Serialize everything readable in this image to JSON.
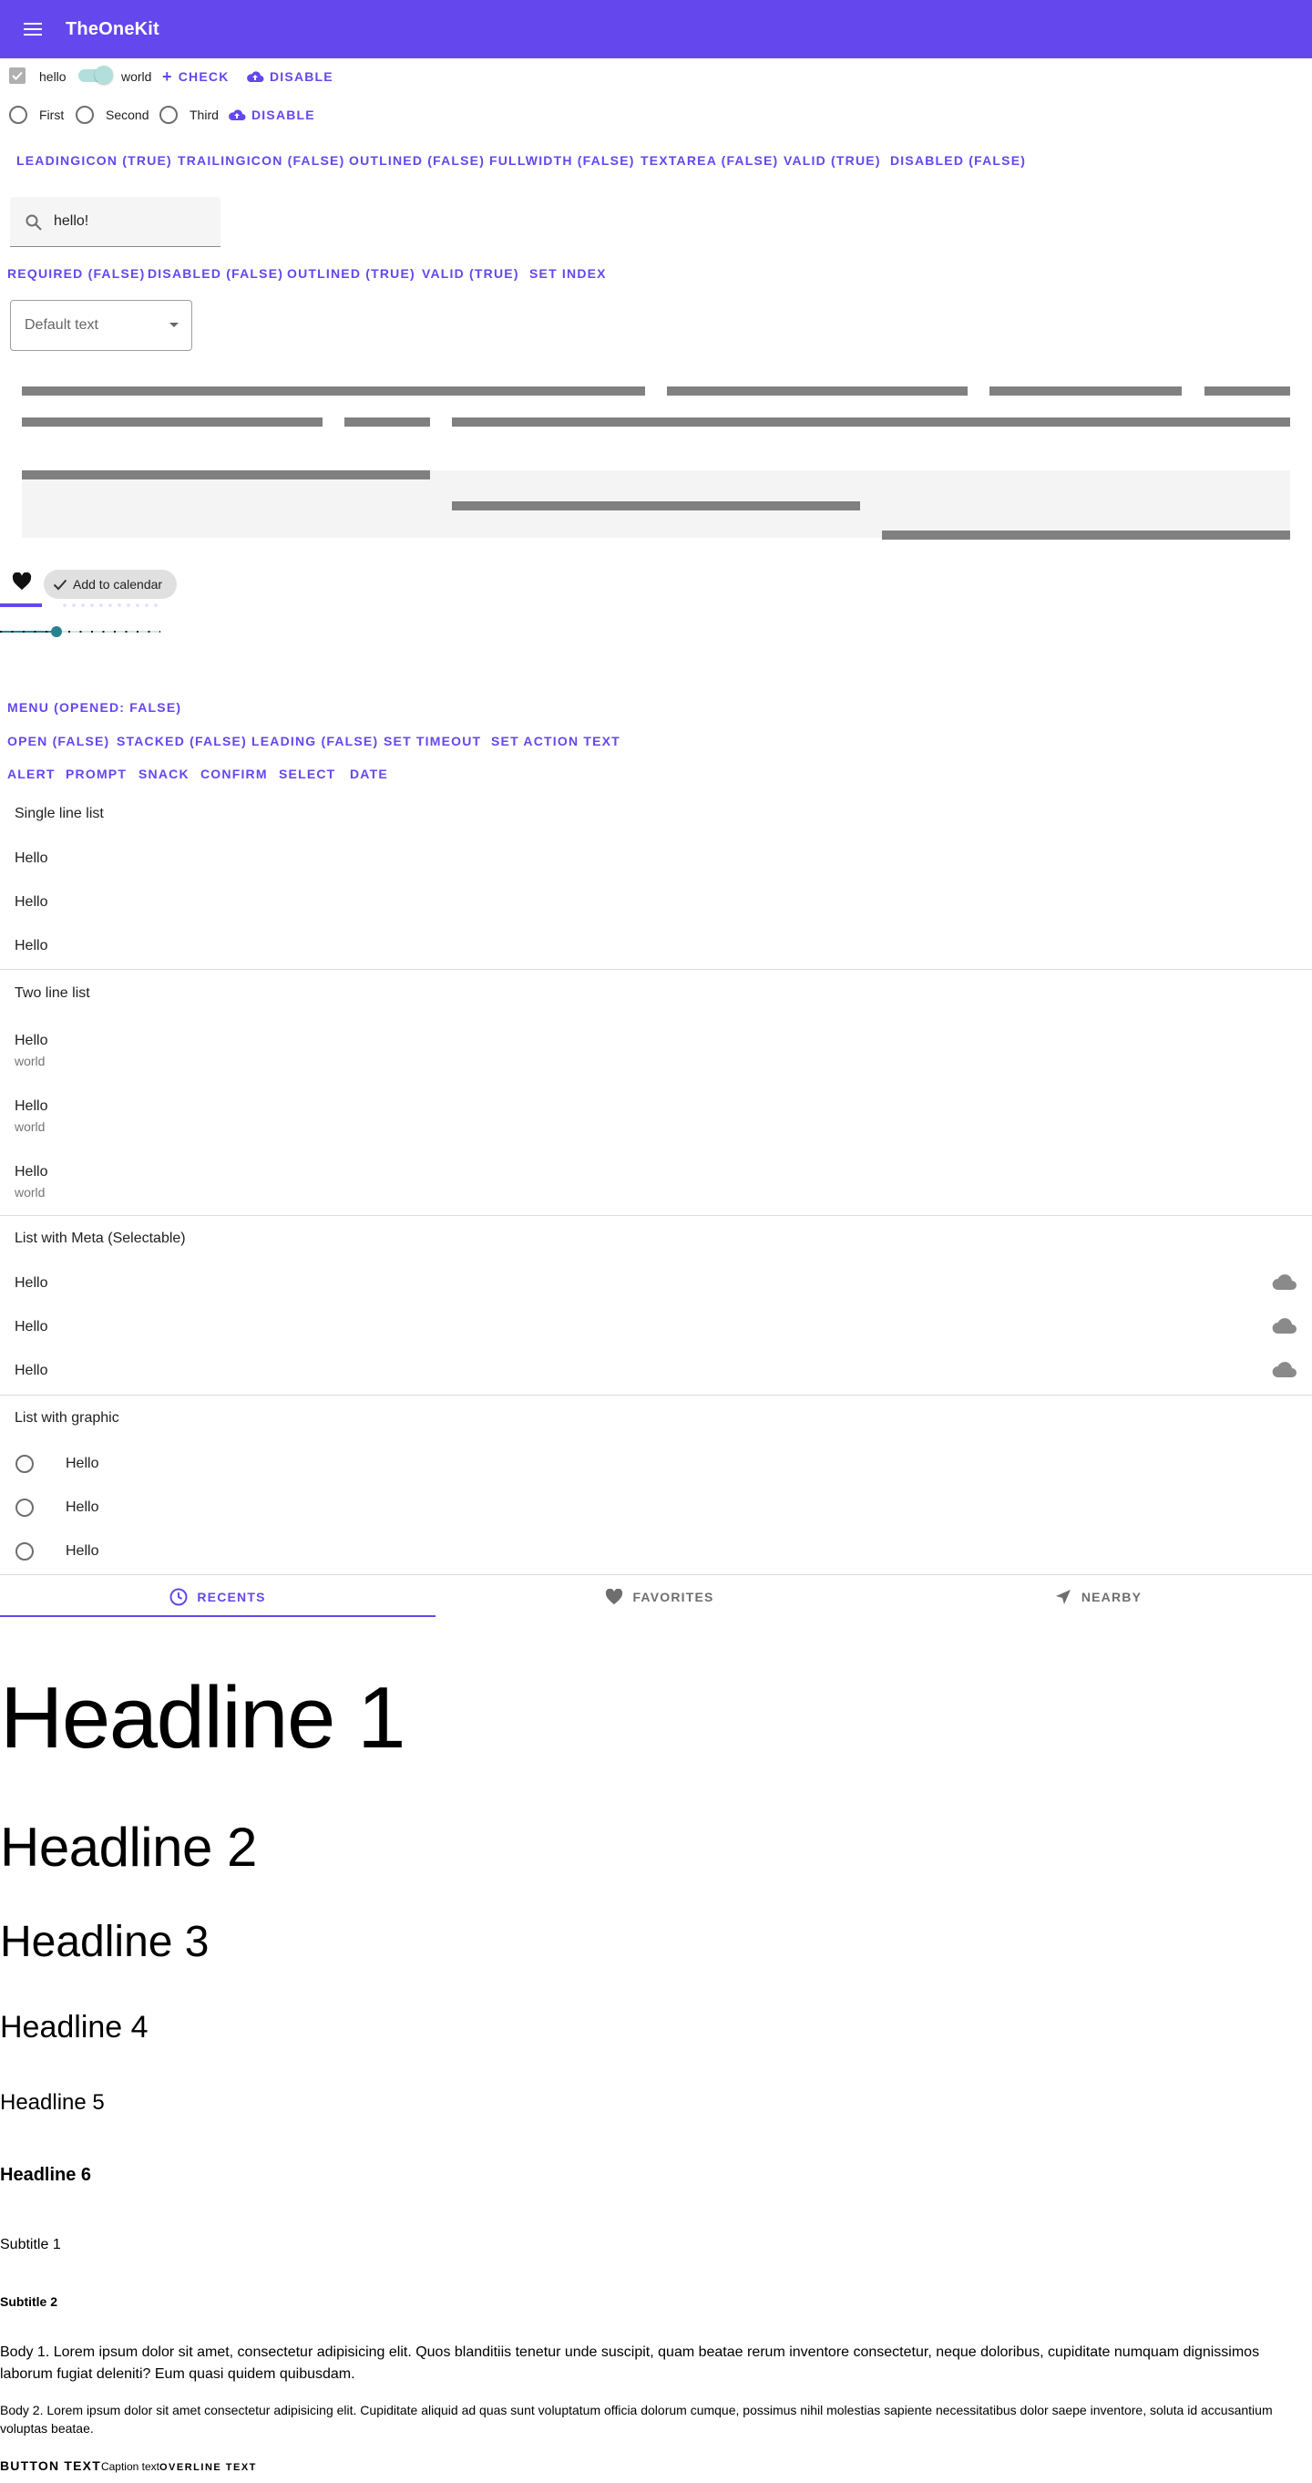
{
  "appbar": {
    "title": "TheOneKit"
  },
  "row1": {
    "checkbox_label": "hello",
    "switch_label": "world",
    "check_btn": "Check",
    "disable_btn": "Disable"
  },
  "row2": {
    "radio1": "First",
    "radio2": "Second",
    "radio3": "Third",
    "disable_btn": "Disable"
  },
  "textfield_opts": [
    "leadingIcon (true)",
    "trailingIcon (false)",
    "outlined (false)",
    "fullwidth (false)",
    "textarea (false)",
    "valid (true)",
    "disabled (false)"
  ],
  "textfield": {
    "value": "hello!"
  },
  "select_opts": [
    "required (false)",
    "disabled (false)",
    "outlined (true)",
    "valid (true)",
    "set index"
  ],
  "select": {
    "value": "Default text"
  },
  "chip": {
    "label": "Add to calendar"
  },
  "progress": {
    "value": 0.35
  },
  "slider": {
    "value": 0.35
  },
  "menu_btn": "menu (opened: false)",
  "snackbar_opts": [
    "open (false)",
    "stacked (false)",
    "leading (false)",
    "set timeout",
    "set action text"
  ],
  "dialog_btns": [
    "alert",
    "prompt",
    "snack",
    "confirm",
    "select",
    "date"
  ],
  "lists": {
    "single": {
      "header": "Single line list",
      "items": [
        "Hello",
        "Hello",
        "Hello"
      ]
    },
    "two": {
      "header": "Two line list",
      "items": [
        {
          "primary": "Hello",
          "secondary": "world"
        },
        {
          "primary": "Hello",
          "secondary": "world"
        },
        {
          "primary": "Hello",
          "secondary": "world"
        }
      ]
    },
    "meta": {
      "header": "List with Meta (Selectable)",
      "items": [
        "Hello",
        "Hello",
        "Hello"
      ]
    },
    "graphic": {
      "header": "List with graphic",
      "items": [
        "Hello",
        "Hello",
        "Hello"
      ]
    }
  },
  "tabs": [
    {
      "label": "Recents",
      "icon": "clock-icon"
    },
    {
      "label": "Favorites",
      "icon": "heart-icon"
    },
    {
      "label": "Nearby",
      "icon": "navigation-icon"
    }
  ],
  "typography": {
    "h1": "Headline 1",
    "h2": "Headline 2",
    "h3": "Headline 3",
    "h4": "Headline 4",
    "h5": "Headline 5",
    "h6": "Headline 6",
    "subtitle1": "Subtitle 1",
    "subtitle2": "Subtitle 2",
    "body1": "Body 1. Lorem ipsum dolor sit amet, consectetur adipisicing elit. Quos blanditiis tenetur unde suscipit, quam beatae rerum inventore consectetur, neque doloribus, cupiditate numquam dignissimos laborum fugiat deleniti? Eum quasi quidem quibusdam.",
    "body2": "Body 2. Lorem ipsum dolor sit amet consectetur adipisicing elit. Cupiditate aliquid ad quas sunt voluptatum officia dolorum cumque, possimus nihil molestias sapiente necessitatibus dolor saepe inventore, soluta id accusantium voluptas beatae.",
    "button": "Button text",
    "caption": "Caption text",
    "overline": "Overline text"
  },
  "colors": {
    "primary": "#6547ee",
    "teal": "#26838f"
  }
}
